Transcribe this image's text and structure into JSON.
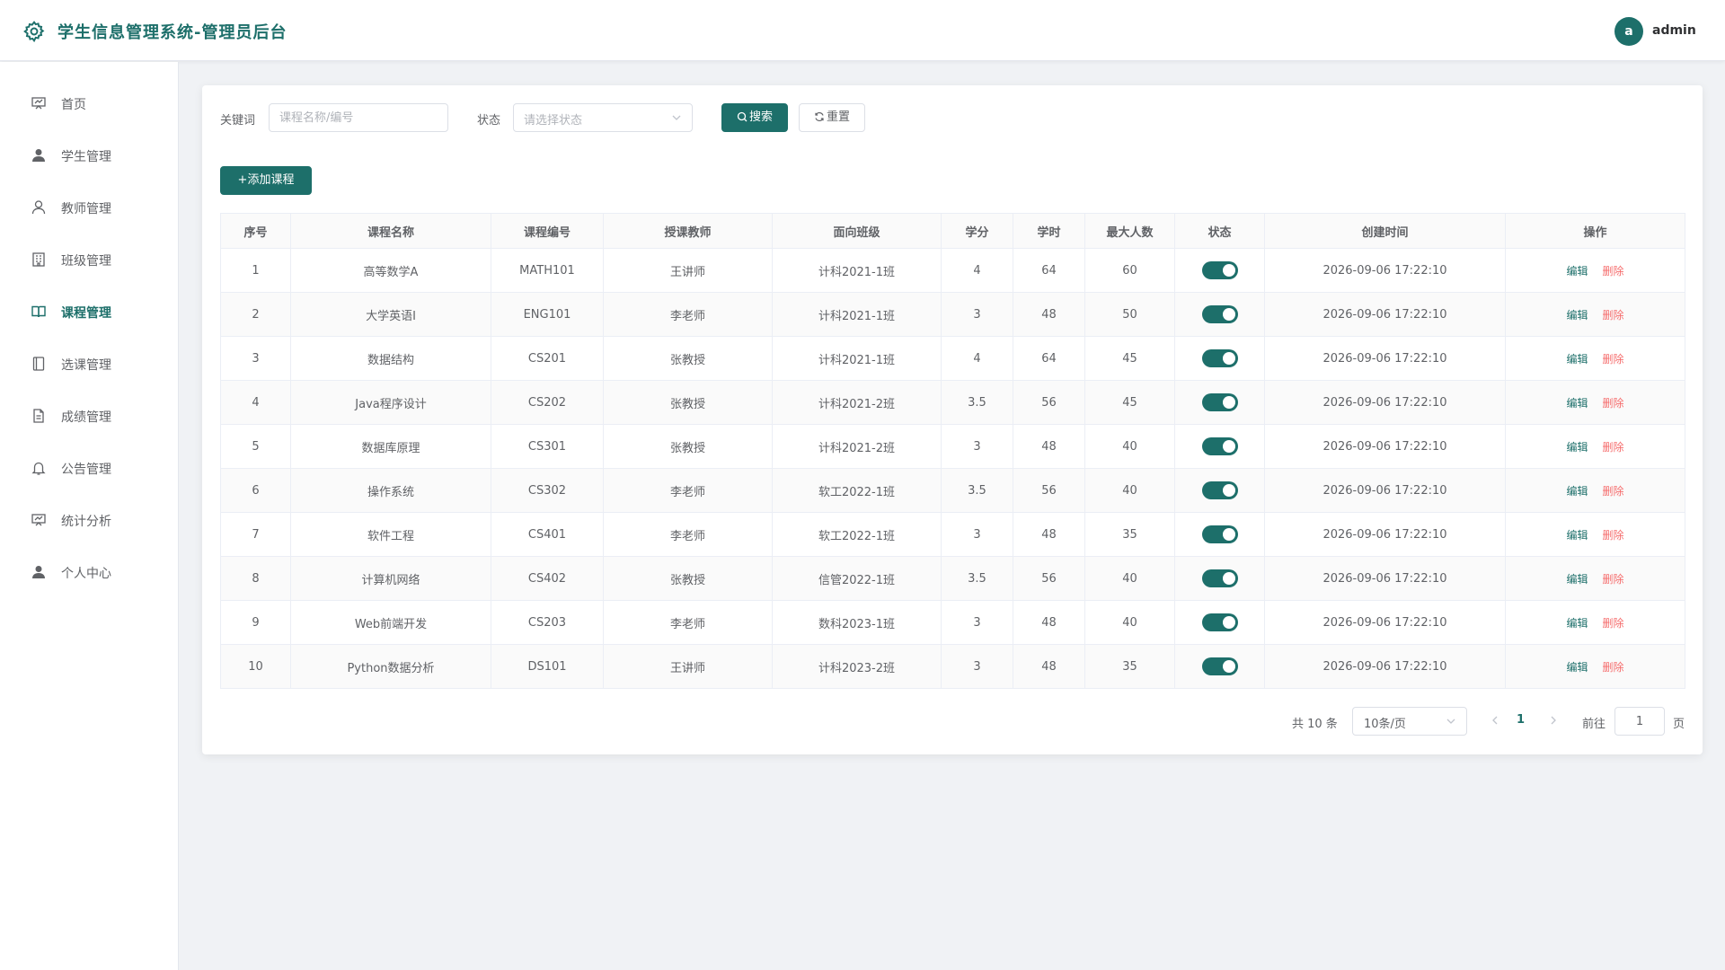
{
  "app": {
    "title": "学生信息管理系统-管理员后台"
  },
  "user": {
    "avatar_letter": "a",
    "name": "admin"
  },
  "sidebar": {
    "items": [
      {
        "label": "首页",
        "icon": "home-icon"
      },
      {
        "label": "学生管理",
        "icon": "user-filled-icon"
      },
      {
        "label": "教师管理",
        "icon": "user-outline-icon"
      },
      {
        "label": "班级管理",
        "icon": "building-icon"
      },
      {
        "label": "课程管理",
        "icon": "book-icon",
        "active": true
      },
      {
        "label": "选课管理",
        "icon": "notebook-icon"
      },
      {
        "label": "成绩管理",
        "icon": "document-icon"
      },
      {
        "label": "公告管理",
        "icon": "bell-icon"
      },
      {
        "label": "统计分析",
        "icon": "chart-icon"
      },
      {
        "label": "个人中心",
        "icon": "user-filled-icon"
      }
    ]
  },
  "filters": {
    "keyword_label": "关键词",
    "keyword_placeholder": "课程名称/编号",
    "keyword_value": "",
    "status_label": "状态",
    "status_placeholder": "请选择状态",
    "search_label": "搜索",
    "reset_label": "重置"
  },
  "toolbar": {
    "add_label": "+添加课程"
  },
  "table": {
    "columns": [
      "序号",
      "课程名称",
      "课程编号",
      "授课教师",
      "面向班级",
      "学分",
      "学时",
      "最大人数",
      "状态",
      "创建时间",
      "操作"
    ],
    "rows": [
      {
        "no": "1",
        "name": "高等数学A",
        "code": "MATH101",
        "teacher": "王讲师",
        "class": "计科2021-1班",
        "credit": "4",
        "hours": "64",
        "max": "60",
        "enabled": true,
        "created": "2026-09-06 17:22:10"
      },
      {
        "no": "2",
        "name": "大学英语I",
        "code": "ENG101",
        "teacher": "李老师",
        "class": "计科2021-1班",
        "credit": "3",
        "hours": "48",
        "max": "50",
        "enabled": true,
        "created": "2026-09-06 17:22:10"
      },
      {
        "no": "3",
        "name": "数据结构",
        "code": "CS201",
        "teacher": "张教授",
        "class": "计科2021-1班",
        "credit": "4",
        "hours": "64",
        "max": "45",
        "enabled": true,
        "created": "2026-09-06 17:22:10"
      },
      {
        "no": "4",
        "name": "Java程序设计",
        "code": "CS202",
        "teacher": "张教授",
        "class": "计科2021-2班",
        "credit": "3.5",
        "hours": "56",
        "max": "45",
        "enabled": true,
        "created": "2026-09-06 17:22:10"
      },
      {
        "no": "5",
        "name": "数据库原理",
        "code": "CS301",
        "teacher": "张教授",
        "class": "计科2021-2班",
        "credit": "3",
        "hours": "48",
        "max": "40",
        "enabled": true,
        "created": "2026-09-06 17:22:10"
      },
      {
        "no": "6",
        "name": "操作系统",
        "code": "CS302",
        "teacher": "李老师",
        "class": "软工2022-1班",
        "credit": "3.5",
        "hours": "56",
        "max": "40",
        "enabled": true,
        "created": "2026-09-06 17:22:10"
      },
      {
        "no": "7",
        "name": "软件工程",
        "code": "CS401",
        "teacher": "李老师",
        "class": "软工2022-1班",
        "credit": "3",
        "hours": "48",
        "max": "35",
        "enabled": true,
        "created": "2026-09-06 17:22:10"
      },
      {
        "no": "8",
        "name": "计算机网络",
        "code": "CS402",
        "teacher": "张教授",
        "class": "信管2022-1班",
        "credit": "3.5",
        "hours": "56",
        "max": "40",
        "enabled": true,
        "created": "2026-09-06 17:22:10"
      },
      {
        "no": "9",
        "name": "Web前端开发",
        "code": "CS203",
        "teacher": "李老师",
        "class": "数科2023-1班",
        "credit": "3",
        "hours": "48",
        "max": "40",
        "enabled": true,
        "created": "2026-09-06 17:22:10"
      },
      {
        "no": "10",
        "name": "Python数据分析",
        "code": "DS101",
        "teacher": "王讲师",
        "class": "计科2023-2班",
        "credit": "3",
        "hours": "48",
        "max": "35",
        "enabled": true,
        "created": "2026-09-06 17:22:10"
      }
    ],
    "edit_label": "编辑",
    "delete_label": "删除"
  },
  "pagination": {
    "total_text": "共 10 条",
    "page_size": "10条/页",
    "current_page": "1",
    "goto_label": "前往",
    "goto_value": "1",
    "page_suffix": "页"
  },
  "colors": {
    "primary": "#1d6f6a",
    "danger": "#f56c6c"
  }
}
